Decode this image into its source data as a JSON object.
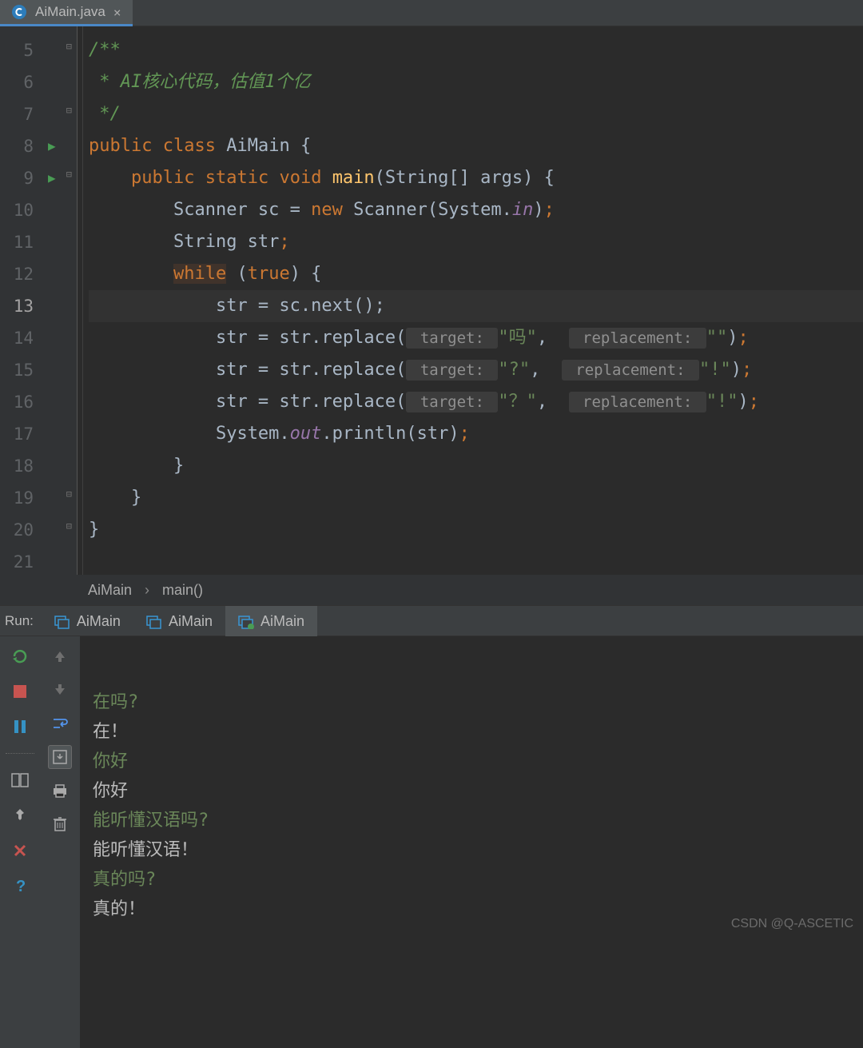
{
  "tab": {
    "filename": "AiMain.java"
  },
  "gutter": {
    "lines": [
      "5",
      "6",
      "7",
      "8",
      "9",
      "10",
      "11",
      "12",
      "13",
      "14",
      "15",
      "16",
      "17",
      "18",
      "19",
      "20",
      "21"
    ],
    "current": 13
  },
  "code": {
    "l5": "/**",
    "l6": " * AI核心代码，估值1个亿",
    "l7": " */",
    "l8_kw1": "public",
    "l8_kw2": "class",
    "l8_cls": "AiMain",
    "l8_br": "{",
    "l9_kw1": "public",
    "l9_kw2": "static",
    "l9_kw3": "void",
    "l9_m": "main",
    "l9_sig": "(String[] args) {",
    "l10_a": "Scanner sc = ",
    "l10_kw": "new",
    "l10_b": " Scanner(System.",
    "l10_f": "in",
    "l10_c": ")",
    "l10_sc": ";",
    "l11_a": "String str",
    "l11_sc": ";",
    "l12_kw": "while",
    "l12_a": " (",
    "l12_kw2": "true",
    "l12_b": ") {",
    "l13": "str = sc.next();",
    "l14_a": "str = str.replace(",
    "l14_h1": " target: ",
    "l14_s1": "\"吗\"",
    "l14_c": ", ",
    "l14_h2": " replacement: ",
    "l14_s2": "\"\"",
    "l14_b": ")",
    "l14_sc": ";",
    "l15_a": "str = str.replace(",
    "l15_h1": " target: ",
    "l15_s1": "\"?\"",
    "l15_c": ", ",
    "l15_h2": " replacement: ",
    "l15_s2": "\"!\"",
    "l15_b": ")",
    "l15_sc": ";",
    "l16_a": "str = str.replace(",
    "l16_h1": " target: ",
    "l16_s1": "\"？\"",
    "l16_c": ", ",
    "l16_h2": " replacement: ",
    "l16_s2": "\"!\"",
    "l16_b": ")",
    "l16_sc": ";",
    "l17_a": "System.",
    "l17_f": "out",
    "l17_b": ".println(str)",
    "l17_sc": ";",
    "l18": "}",
    "l19": "}",
    "l20": "}"
  },
  "breadcrumb": {
    "a": "AiMain",
    "b": "main()"
  },
  "runbar": {
    "label": "Run:",
    "tabs": [
      "AiMain",
      "AiMain",
      "AiMain"
    ],
    "activeIndex": 2
  },
  "console": [
    {
      "cls": "c-in",
      "t": "在吗?"
    },
    {
      "cls": "c-out",
      "t": "在！"
    },
    {
      "cls": "c-in",
      "t": "你好"
    },
    {
      "cls": "c-out",
      "t": "你好"
    },
    {
      "cls": "c-in",
      "t": "能听懂汉语吗?"
    },
    {
      "cls": "c-out",
      "t": "能听懂汉语！"
    },
    {
      "cls": "c-in",
      "t": "真的吗?"
    },
    {
      "cls": "c-out",
      "t": "真的！"
    }
  ],
  "watermark": "CSDN @Q-ASCETIC"
}
